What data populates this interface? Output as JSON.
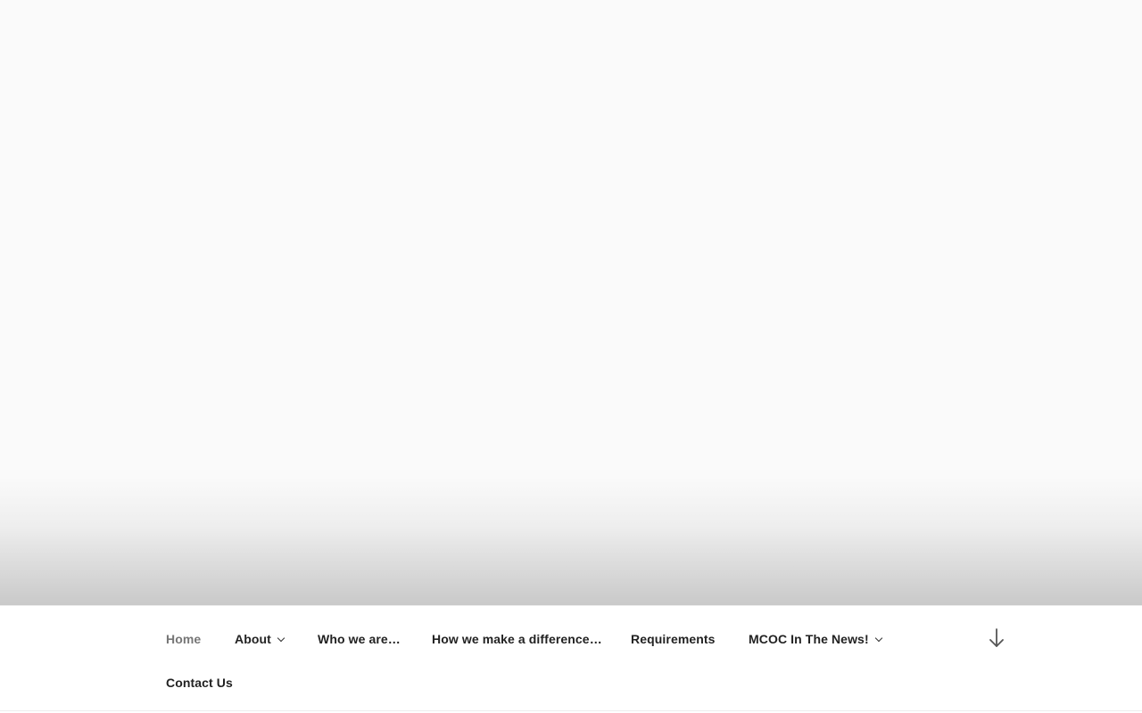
{
  "navigation": {
    "items": [
      {
        "label": "Home",
        "current": true
      },
      {
        "label": "About",
        "has_submenu": true
      },
      {
        "label": "Who we are…"
      },
      {
        "label": "How we make a difference…"
      },
      {
        "label": "Requirements"
      },
      {
        "label": "MCOC In The News!",
        "has_submenu": true
      },
      {
        "label": "Contact Us"
      }
    ],
    "scroll_icon": "arrow-down-icon"
  },
  "colors": {
    "text": "#222222",
    "current_text": "#767676",
    "header_gradient_top": "#fafafa",
    "header_gradient_bottom": "#c9c9c9"
  }
}
